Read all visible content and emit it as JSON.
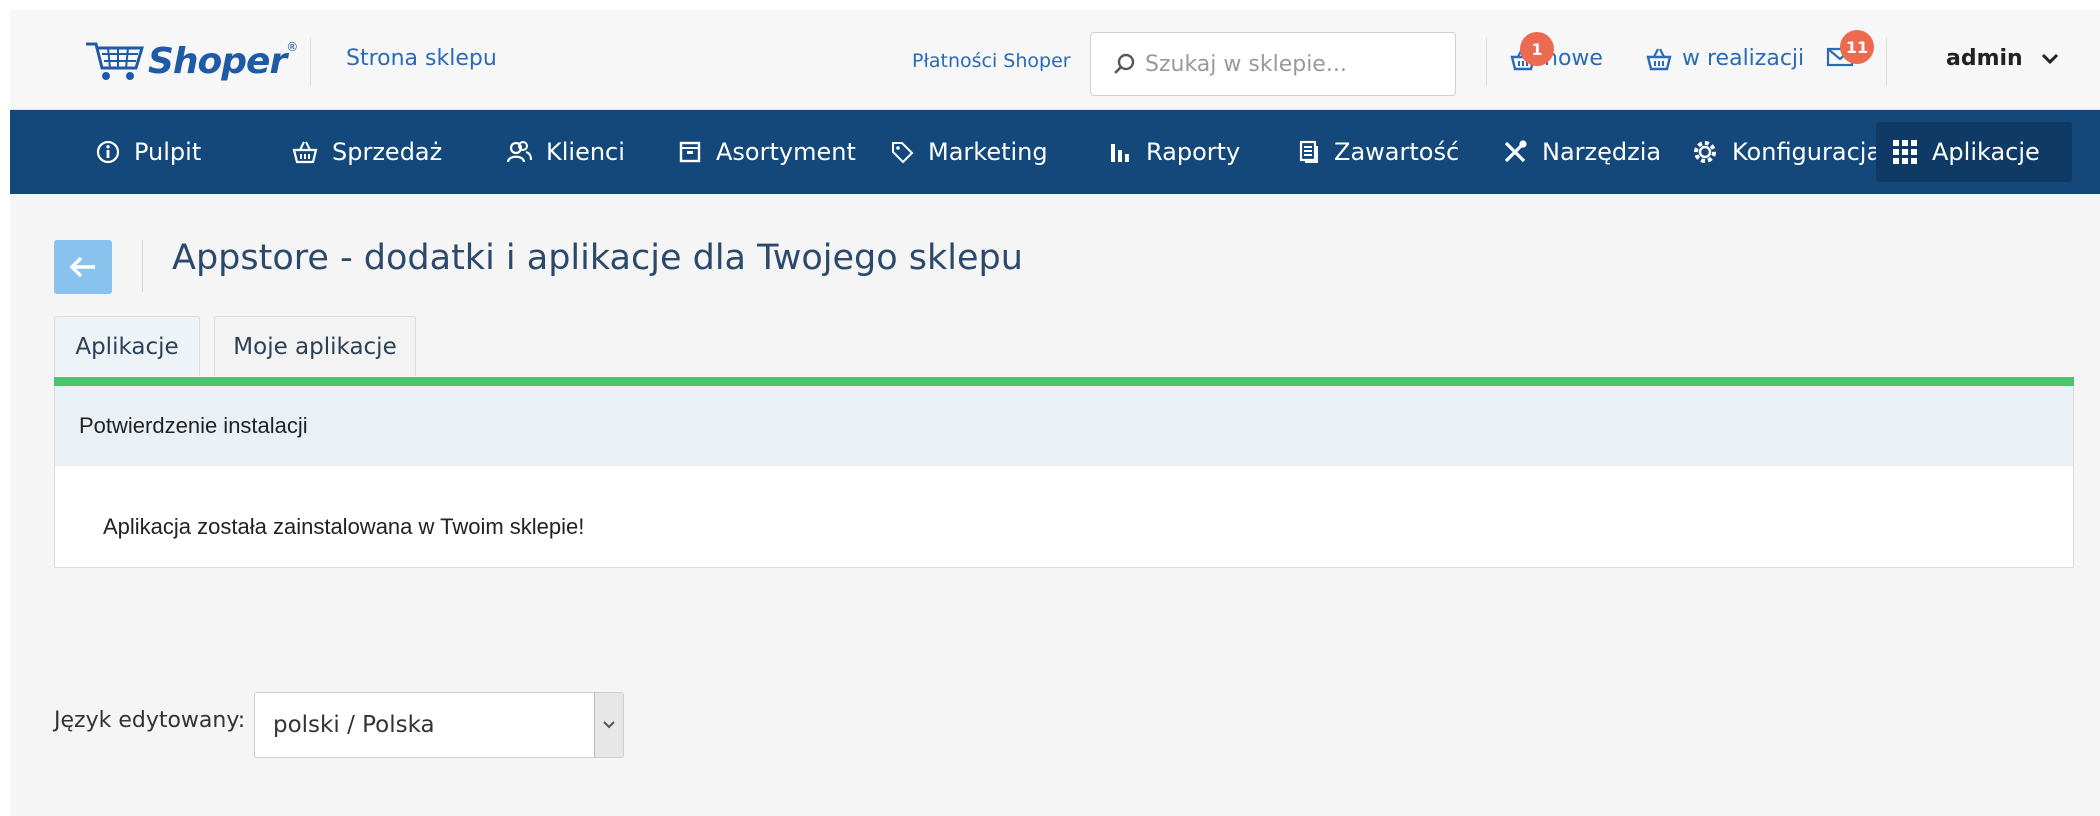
{
  "header": {
    "logo_text": "Shoper",
    "logo_mark": "®",
    "store_link": "Strona sklepu",
    "payments_link": "Płatności Shoper",
    "search_placeholder": "Szukaj w sklepie...",
    "orders_new": {
      "label": "nowe",
      "badge": "1",
      "icon": "basket-icon"
    },
    "orders_in_progress": {
      "label": "w realizacji",
      "icon": "basket-icon"
    },
    "messages": {
      "badge": "11",
      "icon": "envelope-icon"
    },
    "user": "admin"
  },
  "nav": {
    "items": [
      {
        "label": "Pulpit",
        "icon": "info-circle-icon"
      },
      {
        "label": "Sprzedaż",
        "icon": "basket-icon"
      },
      {
        "label": "Klienci",
        "icon": "users-icon"
      },
      {
        "label": "Asortyment",
        "icon": "box-icon"
      },
      {
        "label": "Marketing",
        "icon": "tag-icon"
      },
      {
        "label": "Raporty",
        "icon": "bar-chart-icon"
      },
      {
        "label": "Zawartość",
        "icon": "document-icon"
      },
      {
        "label": "Narzędzia",
        "icon": "tools-icon"
      },
      {
        "label": "Konfiguracja",
        "icon": "gear-icon"
      },
      {
        "label": "Aplikacje",
        "icon": "grid-icon",
        "active": true
      }
    ]
  },
  "page": {
    "title": "Appstore - dodatki i aplikacje dla Twojego sklepu",
    "tabs": [
      {
        "label": "Aplikacje",
        "active": true
      },
      {
        "label": "Moje aplikacje"
      }
    ],
    "panel_title": "Potwierdzenie instalacji",
    "panel_message": "Aplikacja została zainstalowana w Twoim sklepie!"
  },
  "language": {
    "label": "Język edytowany:",
    "selected": "polski / Polska"
  },
  "colors": {
    "nav_bg": "#14487a",
    "accent_blue": "#2a6ab8",
    "success_green": "#4cc36c",
    "badge": "#ec6a4f"
  }
}
